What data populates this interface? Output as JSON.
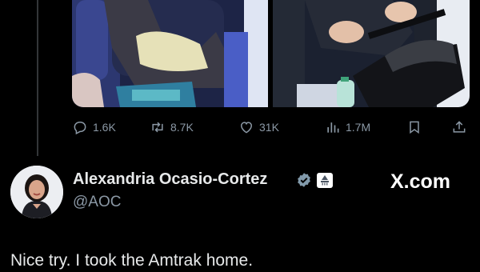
{
  "stats": {
    "replies": "1.6K",
    "reposts": "8.7K",
    "likes": "31K",
    "views": "1.7M"
  },
  "author": {
    "name": "Alexandria Ocasio-Cortez",
    "handle": "@AOC",
    "verified_icon": "verified-checkmark-icon",
    "affiliate_icon": "government-badge-icon"
  },
  "watermark": "X.com",
  "tweet": {
    "text": "Nice try. I took the Amtrak home."
  },
  "colors": {
    "background": "#000000",
    "text": "#e7e9ea",
    "secondary": "#8b98a5",
    "verified": "#829aab"
  }
}
